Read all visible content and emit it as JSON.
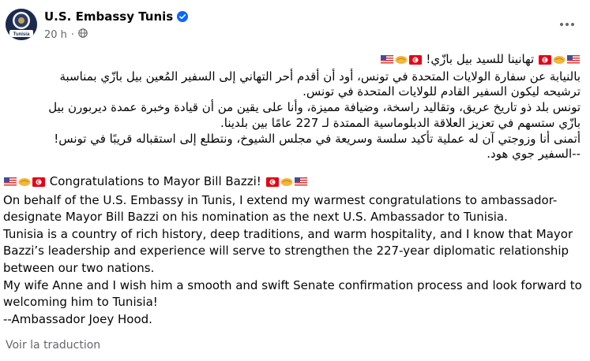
{
  "header": {
    "page_name": "U.S. Embassy Tunis",
    "avatar_text": "Tunisia",
    "timestamp": "20 h",
    "separator": "·"
  },
  "icons": {
    "verified": "verified-badge-icon",
    "audience": "globe-icon",
    "more": "more-options-icon",
    "flags": [
      "usa-flag-icon",
      "tunisia-flag-icon",
      "handshake-icon"
    ]
  },
  "colors": {
    "verified_blue": "#0866ff",
    "text": "#050505",
    "secondary_text": "#65676b",
    "flag_red": "#e70013"
  },
  "post": {
    "arabic_lines": [
      "تهانينا للسيد بيل بازّي!",
      "بالنيابة عن سفارة الولايات المتحدة في تونس، أود أن أقدم أحر التهاني إلى السفير المُعين بيل بازّي بمناسبة",
      "ترشيحه ليكون السفير القادم للولايات المتحدة في تونس.",
      "تونس بلد ذو تاريخ عريق، وتقاليد راسخة، وضيافة مميزة، وأنا على يقين من أن قيادة وخبرة عمدة ديربورن بيل",
      "بازّي ستسهم في تعزيز العلاقة الدبلوماسية الممتدة لـ 227 عامًا بين بلدينا.",
      "أتمنى أنا وزوجتي آن له عملية تأكيد سلسة وسريعة في مجلس الشيوخ، ونتطلع إلى استقباله قريبًا في تونس!",
      "--السفير جوي هود."
    ],
    "english_title": "Congratulations to Mayor Bill Bazzi!",
    "english_lines": [
      "On behalf of the U.S. Embassy in Tunis, I extend my warmest congratulations to ambassador-",
      "designate Mayor Bill Bazzi on his nomination as the next U.S. Ambassador to Tunisia.",
      "Tunisia is a country of rich history, deep traditions, and warm hospitality, and I know that Mayor",
      "Bazzi’s leadership and experience will serve to strengthen the 227-year diplomatic relationship",
      "between our two nations.",
      "My wife Anne and I wish him a smooth and swift Senate confirmation process and look forward to",
      "welcoming him to Tunisia!",
      "--Ambassador Joey Hood."
    ]
  },
  "footer": {
    "see_translation": "Voir la traduction"
  }
}
